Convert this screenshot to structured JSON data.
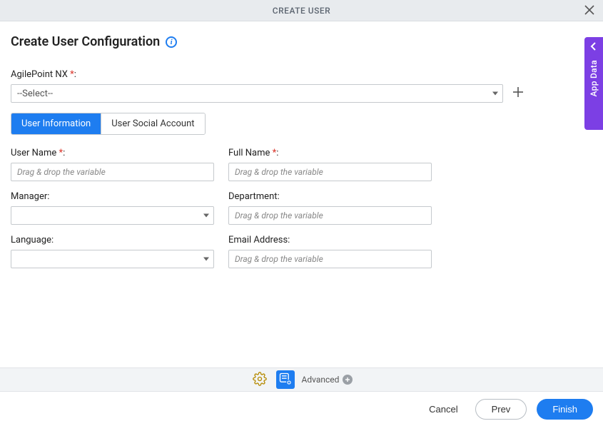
{
  "titlebar": {
    "title": "CREATE USER"
  },
  "page": {
    "heading": "Create User Configuration"
  },
  "agilepoint": {
    "label": "AgilePoint NX",
    "selected": "--Select--"
  },
  "tabs": {
    "user_info": "User Information",
    "social": "User Social Account"
  },
  "fields": {
    "username_label": "User Name",
    "username_placeholder": "Drag & drop the variable",
    "fullname_label": "Full Name",
    "fullname_placeholder": "Drag & drop the variable",
    "manager_label": "Manager:",
    "department_label": "Department:",
    "department_placeholder": "Drag & drop the variable",
    "language_label": "Language:",
    "email_label": "Email Address:",
    "email_placeholder": "Drag & drop the variable"
  },
  "advanced": {
    "label": "Advanced"
  },
  "buttons": {
    "cancel": "Cancel",
    "prev": "Prev",
    "finish": "Finish"
  },
  "side_panel": {
    "label": "App Data"
  },
  "colors": {
    "primary": "#1e7df0",
    "accent": "#7c3fe4"
  }
}
